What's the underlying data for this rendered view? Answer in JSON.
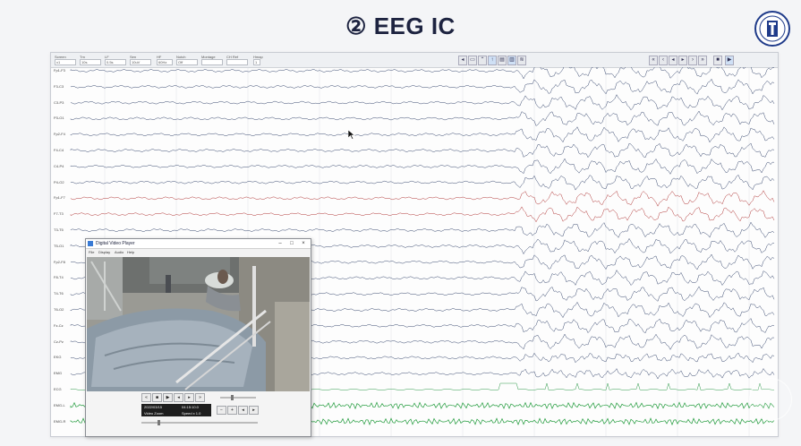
{
  "slide": {
    "title": "② EEG IC"
  },
  "colors": {
    "trace": "#3a4a70",
    "trace_red": "#b23a3a",
    "trace_green": "#1f9a3a",
    "spike": "#2e9a4a",
    "grid": "#d6d9df"
  },
  "eeg": {
    "toolbar_fields": [
      {
        "label": "Screen",
        "value": "x1"
      },
      {
        "label": "Tm",
        "value": "10s"
      },
      {
        "label": "LF",
        "value": "0.5s"
      },
      {
        "label": "Sen",
        "value": "10uV"
      },
      {
        "label": "HF",
        "value": "60Hz"
      },
      {
        "label": "Notch",
        "value": "Off"
      },
      {
        "label": "Montage",
        "value": ""
      },
      {
        "label": "CH Ref",
        "value": ""
      },
      {
        "label": "Hmap",
        "value": "1"
      }
    ],
    "channels": [
      {
        "label": "Fp1-F3",
        "color": "#3a4a70"
      },
      {
        "label": "F3-C3",
        "color": "#3a4a70"
      },
      {
        "label": "C3-P3",
        "color": "#3a4a70"
      },
      {
        "label": "P3-O1",
        "color": "#3a4a70"
      },
      {
        "label": "Fp2-F4",
        "color": "#3a4a70"
      },
      {
        "label": "F4-C4",
        "color": "#3a4a70"
      },
      {
        "label": "C4-P4",
        "color": "#3a4a70"
      },
      {
        "label": "P4-O2",
        "color": "#3a4a70"
      },
      {
        "label": "Fp1-F7",
        "color": "#b23a3a"
      },
      {
        "label": "F7-T3",
        "color": "#b23a3a"
      },
      {
        "label": "T3-T5",
        "color": "#3a4a70"
      },
      {
        "label": "T5-O1",
        "color": "#3a4a70"
      },
      {
        "label": "Fp2-F8",
        "color": "#3a4a70"
      },
      {
        "label": "F8-T4",
        "color": "#3a4a70"
      },
      {
        "label": "T4-T6",
        "color": "#3a4a70"
      },
      {
        "label": "T6-O2",
        "color": "#3a4a70"
      },
      {
        "label": "Fz-Cz",
        "color": "#3a4a70"
      },
      {
        "label": "Cz-Pz",
        "color": "#3a4a70"
      },
      {
        "label": "EKG",
        "color": "#3a4a70"
      },
      {
        "label": "EMG",
        "color": "#3a4a70"
      },
      {
        "label": "ECG",
        "color": "#2e9a4a"
      },
      {
        "label": "EMG-L",
        "color": "#1f9a3a"
      },
      {
        "label": "EMG-R",
        "color": "#1f9a3a"
      }
    ]
  },
  "video_player": {
    "title": "Digital Video Player",
    "menu": [
      "File",
      "Display",
      "Audio",
      "Help"
    ],
    "date": "2022/03/15",
    "time": "04:15:10.0",
    "zoom": "Video Zoom",
    "speed": "Speed x 1.0"
  }
}
